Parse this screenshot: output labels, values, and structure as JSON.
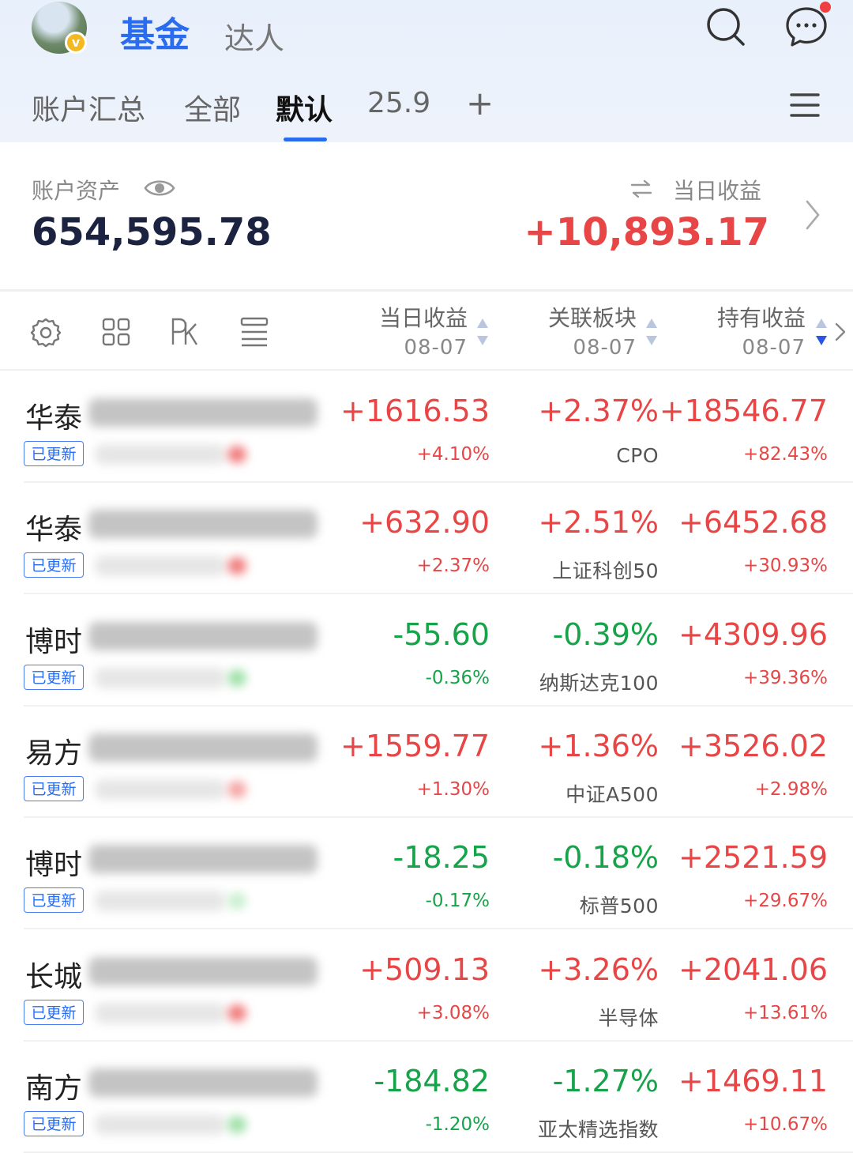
{
  "header": {
    "tabs": [
      {
        "label": "基金",
        "active": true
      },
      {
        "label": "达人",
        "active": false
      }
    ],
    "avatar_badge": "v",
    "icons": [
      "search-icon",
      "message-icon"
    ]
  },
  "group_tabs": [
    {
      "label": "账户汇总",
      "active": false
    },
    {
      "label": "全部",
      "active": false
    },
    {
      "label": "默认",
      "active": true
    },
    {
      "label": "25.9",
      "active": false
    },
    {
      "label": "+",
      "active": false
    }
  ],
  "summary": {
    "assets_label": "账户资产",
    "assets_value": "654,595.78",
    "daily_label": "当日收益",
    "daily_value": "+10,893.17"
  },
  "table_header": {
    "columns": [
      {
        "title": "当日收益",
        "date": "08-07"
      },
      {
        "title": "关联板块",
        "date": "08-07"
      },
      {
        "title": "持有收益",
        "date": "08-07"
      }
    ]
  },
  "colors": {
    "accent": "#2a6cf0",
    "up": "#e84646",
    "down": "#17a34a"
  },
  "funds": [
    {
      "name": "华泰",
      "badge": "已更新",
      "daily": "+1616.53",
      "daily_pct": "+4.10%",
      "sector_pct": "+2.37%",
      "sector": "CPO",
      "hold": "+18546.77",
      "hold_pct": "+82.43%",
      "daily_dir": "up",
      "sector_dir": "up",
      "hold_dir": "up"
    },
    {
      "name": "华泰",
      "badge": "已更新",
      "daily": "+632.90",
      "daily_pct": "+2.37%",
      "sector_pct": "+2.51%",
      "sector": "上证科创50",
      "hold": "+6452.68",
      "hold_pct": "+30.93%",
      "daily_dir": "up",
      "sector_dir": "up",
      "hold_dir": "up"
    },
    {
      "name": "博时",
      "badge": "已更新",
      "daily": "-55.60",
      "daily_pct": "-0.36%",
      "sector_pct": "-0.39%",
      "sector": "纳斯达克100",
      "hold": "+4309.96",
      "hold_pct": "+39.36%",
      "daily_dir": "down",
      "sector_dir": "down",
      "hold_dir": "up"
    },
    {
      "name": "易方",
      "badge": "已更新",
      "daily": "+1559.77",
      "daily_pct": "+1.30%",
      "sector_pct": "+1.36%",
      "sector": "中证A500",
      "hold": "+3526.02",
      "hold_pct": "+2.98%",
      "daily_dir": "up",
      "sector_dir": "up",
      "hold_dir": "up"
    },
    {
      "name": "博时",
      "badge": "已更新",
      "daily": "-18.25",
      "daily_pct": "-0.17%",
      "sector_pct": "-0.18%",
      "sector": "标普500",
      "hold": "+2521.59",
      "hold_pct": "+29.67%",
      "daily_dir": "down",
      "sector_dir": "down",
      "hold_dir": "up"
    },
    {
      "name": "长城",
      "badge": "已更新",
      "daily": "+509.13",
      "daily_pct": "+3.08%",
      "sector_pct": "+3.26%",
      "sector": "半导体",
      "hold": "+2041.06",
      "hold_pct": "+13.61%",
      "daily_dir": "up",
      "sector_dir": "up",
      "hold_dir": "up"
    },
    {
      "name": "南方",
      "badge": "已更新",
      "daily": "-184.82",
      "daily_pct": "-1.20%",
      "sector_pct": "-1.27%",
      "sector": "亚太精选指数",
      "hold": "+1469.11",
      "hold_pct": "+10.67%",
      "daily_dir": "down",
      "sector_dir": "down",
      "hold_dir": "up"
    }
  ]
}
